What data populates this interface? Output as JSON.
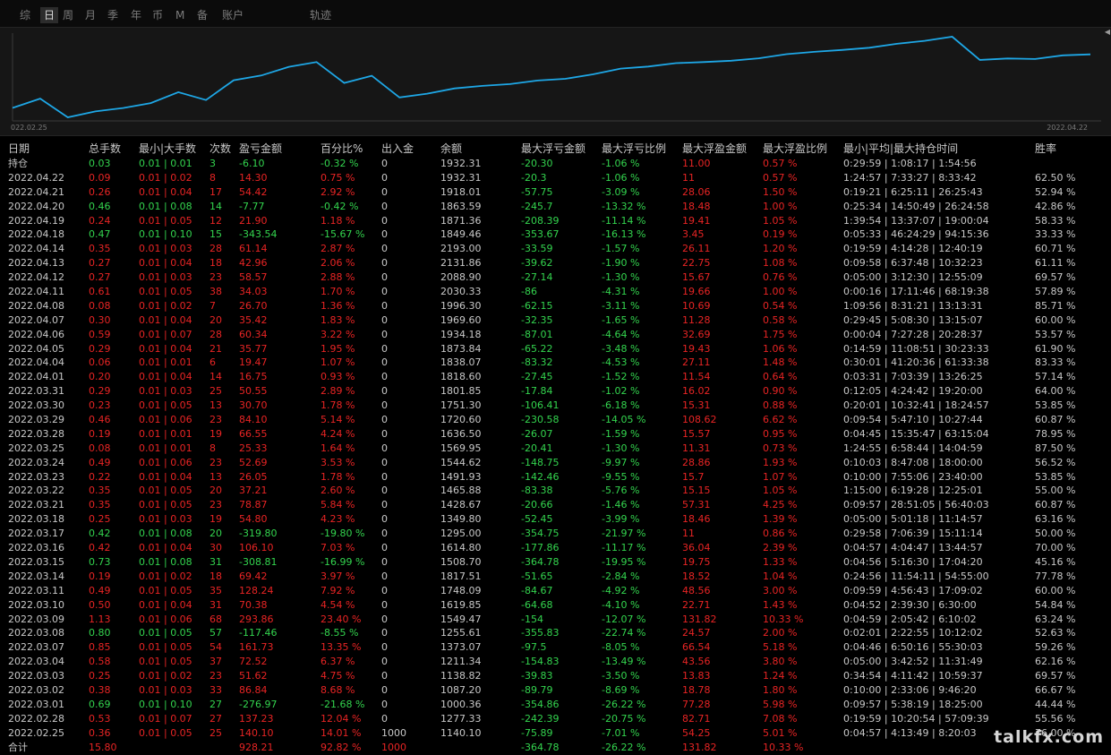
{
  "tabs": [
    {
      "label": "综",
      "active": false
    },
    {
      "label": "日",
      "active": true
    },
    {
      "label": "周",
      "active": false
    },
    {
      "label": "月",
      "active": false
    },
    {
      "label": "季",
      "active": false
    },
    {
      "label": "年",
      "active": false
    },
    {
      "label": "币",
      "active": false
    },
    {
      "label": "M",
      "active": false
    },
    {
      "label": "备",
      "active": false
    },
    {
      "label": "账户",
      "active": false
    },
    {
      "label": "轨迹",
      "active": false
    }
  ],
  "chart": {
    "date_start": "022.02.25",
    "date_end": "2022.04.22",
    "line_color": "#1ea7e6",
    "values": [
      1140.1,
      1277.33,
      1000.36,
      1087.2,
      1138.82,
      1211.34,
      1373.07,
      1255.61,
      1549.47,
      1619.85,
      1748.09,
      1817.51,
      1508.7,
      1614.8,
      1295.0,
      1349.8,
      1428.67,
      1465.88,
      1491.93,
      1544.62,
      1569.95,
      1636.5,
      1720.6,
      1751.3,
      1801.85,
      1818.6,
      1838.07,
      1873.84,
      1934.18,
      1969.6,
      1996.3,
      2030.33,
      2088.9,
      2131.86,
      2193.0,
      1849.46,
      1871.36,
      1863.59,
      1918.01,
      1932.31
    ]
  },
  "headers": [
    "日期",
    "总手数",
    "最小|大手数",
    "次数",
    "盈亏金额",
    "百分比%",
    "出入金",
    "余额",
    "最大浮亏金额",
    "最大浮亏比例",
    "最大浮盈金额",
    "最大浮盈比例",
    "最小|平均|最大持仓时间",
    "胜率"
  ],
  "holding": {
    "date": "持仓",
    "lots": "0.03",
    "minmax": "0.01 | 0.01",
    "count": "3",
    "pnl": "-6.10",
    "pct": "-0.32 %",
    "io": "0",
    "balance": "1932.31",
    "maxloss": "-20.30",
    "maxlosspct": "-1.06 %",
    "maxprofit": "11.00",
    "maxprofitpct": "0.57 %",
    "time": "0:29:59 | 1:08:17 | 1:54:56",
    "win": ""
  },
  "rows": [
    {
      "date": "2022.04.22",
      "lots": "0.09",
      "minmax": "0.01 | 0.02",
      "count": "8",
      "pnl": "14.30",
      "pct": "0.75 %",
      "io": "0",
      "balance": "1932.31",
      "maxloss": "-20.3",
      "maxlosspct": "-1.06 %",
      "maxprofit": "11",
      "maxprofitpct": "0.57 %",
      "time": "1:24:57 | 7:33:27 | 8:33:42",
      "win": "62.50 %"
    },
    {
      "date": "2022.04.21",
      "lots": "0.26",
      "minmax": "0.01 | 0.04",
      "count": "17",
      "pnl": "54.42",
      "pct": "2.92 %",
      "io": "0",
      "balance": "1918.01",
      "maxloss": "-57.75",
      "maxlosspct": "-3.09 %",
      "maxprofit": "28.06",
      "maxprofitpct": "1.50 %",
      "time": "0:19:21 | 6:25:11 | 26:25:43",
      "win": "52.94 %"
    },
    {
      "date": "2022.04.20",
      "lots": "0.46",
      "minmax": "0.01 | 0.08",
      "count": "14",
      "pnl": "-7.77",
      "pct": "-0.42 %",
      "io": "0",
      "balance": "1863.59",
      "maxloss": "-245.7",
      "maxlosspct": "-13.32 %",
      "maxprofit": "18.48",
      "maxprofitpct": "1.00 %",
      "time": "0:25:34 | 14:50:49 | 26:24:58",
      "win": "42.86 %"
    },
    {
      "date": "2022.04.19",
      "lots": "0.24",
      "minmax": "0.01 | 0.05",
      "count": "12",
      "pnl": "21.90",
      "pct": "1.18 %",
      "io": "0",
      "balance": "1871.36",
      "maxloss": "-208.39",
      "maxlosspct": "-11.14 %",
      "maxprofit": "19.41",
      "maxprofitpct": "1.05 %",
      "time": "1:39:54 | 13:37:07 | 19:00:04",
      "win": "58.33 %"
    },
    {
      "date": "2022.04.18",
      "lots": "0.47",
      "minmax": "0.01 | 0.10",
      "count": "15",
      "pnl": "-343.54",
      "pct": "-15.67 %",
      "io": "0",
      "balance": "1849.46",
      "maxloss": "-353.67",
      "maxlosspct": "-16.13 %",
      "maxprofit": "3.45",
      "maxprofitpct": "0.19 %",
      "time": "0:05:33 | 46:24:29 | 94:15:36",
      "win": "33.33 %"
    },
    {
      "date": "2022.04.14",
      "lots": "0.35",
      "minmax": "0.01 | 0.03",
      "count": "28",
      "pnl": "61.14",
      "pct": "2.87 %",
      "io": "0",
      "balance": "2193.00",
      "maxloss": "-33.59",
      "maxlosspct": "-1.57 %",
      "maxprofit": "26.11",
      "maxprofitpct": "1.20 %",
      "time": "0:19:59 | 4:14:28 | 12:40:19",
      "win": "60.71 %"
    },
    {
      "date": "2022.04.13",
      "lots": "0.27",
      "minmax": "0.01 | 0.04",
      "count": "18",
      "pnl": "42.96",
      "pct": "2.06 %",
      "io": "0",
      "balance": "2131.86",
      "maxloss": "-39.62",
      "maxlosspct": "-1.90 %",
      "maxprofit": "22.75",
      "maxprofitpct": "1.08 %",
      "time": "0:09:58 | 6:37:48 | 10:32:23",
      "win": "61.11 %"
    },
    {
      "date": "2022.04.12",
      "lots": "0.27",
      "minmax": "0.01 | 0.03",
      "count": "23",
      "pnl": "58.57",
      "pct": "2.88 %",
      "io": "0",
      "balance": "2088.90",
      "maxloss": "-27.14",
      "maxlosspct": "-1.30 %",
      "maxprofit": "15.67",
      "maxprofitpct": "0.76 %",
      "time": "0:05:00 | 3:12:30 | 12:55:09",
      "win": "69.57 %"
    },
    {
      "date": "2022.04.11",
      "lots": "0.61",
      "minmax": "0.01 | 0.05",
      "count": "38",
      "pnl": "34.03",
      "pct": "1.70 %",
      "io": "0",
      "balance": "2030.33",
      "maxloss": "-86",
      "maxlosspct": "-4.31 %",
      "maxprofit": "19.66",
      "maxprofitpct": "1.00 %",
      "time": "0:00:16 | 17:11:46 | 68:19:38",
      "win": "57.89 %"
    },
    {
      "date": "2022.04.08",
      "lots": "0.08",
      "minmax": "0.01 | 0.02",
      "count": "7",
      "pnl": "26.70",
      "pct": "1.36 %",
      "io": "0",
      "balance": "1996.30",
      "maxloss": "-62.15",
      "maxlosspct": "-3.11 %",
      "maxprofit": "10.69",
      "maxprofitpct": "0.54 %",
      "time": "1:09:56 | 8:31:21 | 13:13:31",
      "win": "85.71 %"
    },
    {
      "date": "2022.04.07",
      "lots": "0.30",
      "minmax": "0.01 | 0.04",
      "count": "20",
      "pnl": "35.42",
      "pct": "1.83 %",
      "io": "0",
      "balance": "1969.60",
      "maxloss": "-32.35",
      "maxlosspct": "-1.65 %",
      "maxprofit": "11.28",
      "maxprofitpct": "0.58 %",
      "time": "0:29:45 | 5:08:30 | 13:15:07",
      "win": "60.00 %"
    },
    {
      "date": "2022.04.06",
      "lots": "0.59",
      "minmax": "0.01 | 0.07",
      "count": "28",
      "pnl": "60.34",
      "pct": "3.22 %",
      "io": "0",
      "balance": "1934.18",
      "maxloss": "-87.01",
      "maxlosspct": "-4.64 %",
      "maxprofit": "32.69",
      "maxprofitpct": "1.75 %",
      "time": "0:00:04 | 7:27:28 | 20:28:37",
      "win": "53.57 %"
    },
    {
      "date": "2022.04.05",
      "lots": "0.29",
      "minmax": "0.01 | 0.04",
      "count": "21",
      "pnl": "35.77",
      "pct": "1.95 %",
      "io": "0",
      "balance": "1873.84",
      "maxloss": "-65.22",
      "maxlosspct": "-3.48 %",
      "maxprofit": "19.43",
      "maxprofitpct": "1.06 %",
      "time": "0:14:59 | 11:08:51 | 30:23:33",
      "win": "61.90 %"
    },
    {
      "date": "2022.04.04",
      "lots": "0.06",
      "minmax": "0.01 | 0.01",
      "count": "6",
      "pnl": "19.47",
      "pct": "1.07 %",
      "io": "0",
      "balance": "1838.07",
      "maxloss": "-83.32",
      "maxlosspct": "-4.53 %",
      "maxprofit": "27.11",
      "maxprofitpct": "1.48 %",
      "time": "0:30:01 | 41:20:36 | 61:33:38",
      "win": "83.33 %"
    },
    {
      "date": "2022.04.01",
      "lots": "0.20",
      "minmax": "0.01 | 0.04",
      "count": "14",
      "pnl": "16.75",
      "pct": "0.93 %",
      "io": "0",
      "balance": "1818.60",
      "maxloss": "-27.45",
      "maxlosspct": "-1.52 %",
      "maxprofit": "11.54",
      "maxprofitpct": "0.64 %",
      "time": "0:03:31 | 7:03:39 | 13:26:25",
      "win": "57.14 %"
    },
    {
      "date": "2022.03.31",
      "lots": "0.29",
      "minmax": "0.01 | 0.03",
      "count": "25",
      "pnl": "50.55",
      "pct": "2.89 %",
      "io": "0",
      "balance": "1801.85",
      "maxloss": "-17.84",
      "maxlosspct": "-1.02 %",
      "maxprofit": "16.02",
      "maxprofitpct": "0.90 %",
      "time": "0:12:05 | 4:24:42 | 19:20:00",
      "win": "64.00 %"
    },
    {
      "date": "2022.03.30",
      "lots": "0.23",
      "minmax": "0.01 | 0.05",
      "count": "13",
      "pnl": "30.70",
      "pct": "1.78 %",
      "io": "0",
      "balance": "1751.30",
      "maxloss": "-106.41",
      "maxlosspct": "-6.18 %",
      "maxprofit": "15.31",
      "maxprofitpct": "0.88 %",
      "time": "0:20:01 | 10:32:41 | 18:24:57",
      "win": "53.85 %"
    },
    {
      "date": "2022.03.29",
      "lots": "0.46",
      "minmax": "0.01 | 0.06",
      "count": "23",
      "pnl": "84.10",
      "pct": "5.14 %",
      "io": "0",
      "balance": "1720.60",
      "maxloss": "-230.58",
      "maxlosspct": "-14.05 %",
      "maxprofit": "108.62",
      "maxprofitpct": "6.62 %",
      "time": "0:09:54 | 5:47:10 | 10:27:44",
      "win": "60.87 %"
    },
    {
      "date": "2022.03.28",
      "lots": "0.19",
      "minmax": "0.01 | 0.01",
      "count": "19",
      "pnl": "66.55",
      "pct": "4.24 %",
      "io": "0",
      "balance": "1636.50",
      "maxloss": "-26.07",
      "maxlosspct": "-1.59 %",
      "maxprofit": "15.57",
      "maxprofitpct": "0.95 %",
      "time": "0:04:45 | 15:35:47 | 63:15:04",
      "win": "78.95 %"
    },
    {
      "date": "2022.03.25",
      "lots": "0.08",
      "minmax": "0.01 | 0.01",
      "count": "8",
      "pnl": "25.33",
      "pct": "1.64 %",
      "io": "0",
      "balance": "1569.95",
      "maxloss": "-20.41",
      "maxlosspct": "-1.30 %",
      "maxprofit": "11.31",
      "maxprofitpct": "0.73 %",
      "time": "1:24:55 | 6:58:44 | 14:04:59",
      "win": "87.50 %"
    },
    {
      "date": "2022.03.24",
      "lots": "0.49",
      "minmax": "0.01 | 0.06",
      "count": "23",
      "pnl": "52.69",
      "pct": "3.53 %",
      "io": "0",
      "balance": "1544.62",
      "maxloss": "-148.75",
      "maxlosspct": "-9.97 %",
      "maxprofit": "28.86",
      "maxprofitpct": "1.93 %",
      "time": "0:10:03 | 8:47:08 | 18:00:00",
      "win": "56.52 %"
    },
    {
      "date": "2022.03.23",
      "lots": "0.22",
      "minmax": "0.01 | 0.04",
      "count": "13",
      "pnl": "26.05",
      "pct": "1.78 %",
      "io": "0",
      "balance": "1491.93",
      "maxloss": "-142.46",
      "maxlosspct": "-9.55 %",
      "maxprofit": "15.7",
      "maxprofitpct": "1.07 %",
      "time": "0:10:00 | 7:55:06 | 23:40:00",
      "win": "53.85 %"
    },
    {
      "date": "2022.03.22",
      "lots": "0.35",
      "minmax": "0.01 | 0.05",
      "count": "20",
      "pnl": "37.21",
      "pct": "2.60 %",
      "io": "0",
      "balance": "1465.88",
      "maxloss": "-83.38",
      "maxlosspct": "-5.76 %",
      "maxprofit": "15.15",
      "maxprofitpct": "1.05 %",
      "time": "1:15:00 | 6:19:28 | 12:25:01",
      "win": "55.00 %"
    },
    {
      "date": "2022.03.21",
      "lots": "0.35",
      "minmax": "0.01 | 0.05",
      "count": "23",
      "pnl": "78.87",
      "pct": "5.84 %",
      "io": "0",
      "balance": "1428.67",
      "maxloss": "-20.66",
      "maxlosspct": "-1.46 %",
      "maxprofit": "57.31",
      "maxprofitpct": "4.25 %",
      "time": "0:09:57 | 28:51:05 | 56:40:03",
      "win": "60.87 %"
    },
    {
      "date": "2022.03.18",
      "lots": "0.25",
      "minmax": "0.01 | 0.03",
      "count": "19",
      "pnl": "54.80",
      "pct": "4.23 %",
      "io": "0",
      "balance": "1349.80",
      "maxloss": "-52.45",
      "maxlosspct": "-3.99 %",
      "maxprofit": "18.46",
      "maxprofitpct": "1.39 %",
      "time": "0:05:00 | 5:01:18 | 11:14:57",
      "win": "63.16 %"
    },
    {
      "date": "2022.03.17",
      "lots": "0.42",
      "minmax": "0.01 | 0.08",
      "count": "20",
      "pnl": "-319.80",
      "pct": "-19.80 %",
      "io": "0",
      "balance": "1295.00",
      "maxloss": "-354.75",
      "maxlosspct": "-21.97 %",
      "maxprofit": "11",
      "maxprofitpct": "0.86 %",
      "time": "0:29:58 | 7:06:39 | 15:11:14",
      "win": "50.00 %"
    },
    {
      "date": "2022.03.16",
      "lots": "0.42",
      "minmax": "0.01 | 0.04",
      "count": "30",
      "pnl": "106.10",
      "pct": "7.03 %",
      "io": "0",
      "balance": "1614.80",
      "maxloss": "-177.86",
      "maxlosspct": "-11.17 %",
      "maxprofit": "36.04",
      "maxprofitpct": "2.39 %",
      "time": "0:04:57 | 4:04:47 | 13:44:57",
      "win": "70.00 %"
    },
    {
      "date": "2022.03.15",
      "lots": "0.73",
      "minmax": "0.01 | 0.08",
      "count": "31",
      "pnl": "-308.81",
      "pct": "-16.99 %",
      "io": "0",
      "balance": "1508.70",
      "maxloss": "-364.78",
      "maxlosspct": "-19.95 %",
      "maxprofit": "19.75",
      "maxprofitpct": "1.33 %",
      "time": "0:04:56 | 5:16:30 | 17:04:20",
      "win": "45.16 %"
    },
    {
      "date": "2022.03.14",
      "lots": "0.19",
      "minmax": "0.01 | 0.02",
      "count": "18",
      "pnl": "69.42",
      "pct": "3.97 %",
      "io": "0",
      "balance": "1817.51",
      "maxloss": "-51.65",
      "maxlosspct": "-2.84 %",
      "maxprofit": "18.52",
      "maxprofitpct": "1.04 %",
      "time": "0:24:56 | 11:54:11 | 54:55:00",
      "win": "77.78 %"
    },
    {
      "date": "2022.03.11",
      "lots": "0.49",
      "minmax": "0.01 | 0.05",
      "count": "35",
      "pnl": "128.24",
      "pct": "7.92 %",
      "io": "0",
      "balance": "1748.09",
      "maxloss": "-84.67",
      "maxlosspct": "-4.92 %",
      "maxprofit": "48.56",
      "maxprofitpct": "3.00 %",
      "time": "0:09:59 | 4:56:43 | 17:09:02",
      "win": "60.00 %"
    },
    {
      "date": "2022.03.10",
      "lots": "0.50",
      "minmax": "0.01 | 0.04",
      "count": "31",
      "pnl": "70.38",
      "pct": "4.54 %",
      "io": "0",
      "balance": "1619.85",
      "maxloss": "-64.68",
      "maxlosspct": "-4.10 %",
      "maxprofit": "22.71",
      "maxprofitpct": "1.43 %",
      "time": "0:04:52 | 2:39:30 | 6:30:00",
      "win": "54.84 %"
    },
    {
      "date": "2022.03.09",
      "lots": "1.13",
      "minmax": "0.01 | 0.06",
      "count": "68",
      "pnl": "293.86",
      "pct": "23.40 %",
      "io": "0",
      "balance": "1549.47",
      "maxloss": "-154",
      "maxlosspct": "-12.07 %",
      "maxprofit": "131.82",
      "maxprofitpct": "10.33 %",
      "time": "0:04:59 | 2:05:42 | 6:10:02",
      "win": "63.24 %"
    },
    {
      "date": "2022.03.08",
      "lots": "0.80",
      "minmax": "0.01 | 0.05",
      "count": "57",
      "pnl": "-117.46",
      "pct": "-8.55 %",
      "io": "0",
      "balance": "1255.61",
      "maxloss": "-355.83",
      "maxlosspct": "-22.74 %",
      "maxprofit": "24.57",
      "maxprofitpct": "2.00 %",
      "time": "0:02:01 | 2:22:55 | 10:12:02",
      "win": "52.63 %"
    },
    {
      "date": "2022.03.07",
      "lots": "0.85",
      "minmax": "0.01 | 0.05",
      "count": "54",
      "pnl": "161.73",
      "pct": "13.35 %",
      "io": "0",
      "balance": "1373.07",
      "maxloss": "-97.5",
      "maxlosspct": "-8.05 %",
      "maxprofit": "66.54",
      "maxprofitpct": "5.18 %",
      "time": "0:04:46 | 6:50:16 | 55:30:03",
      "win": "59.26 %"
    },
    {
      "date": "2022.03.04",
      "lots": "0.58",
      "minmax": "0.01 | 0.05",
      "count": "37",
      "pnl": "72.52",
      "pct": "6.37 %",
      "io": "0",
      "balance": "1211.34",
      "maxloss": "-154.83",
      "maxlosspct": "-13.49 %",
      "maxprofit": "43.56",
      "maxprofitpct": "3.80 %",
      "time": "0:05:00 | 3:42:52 | 11:31:49",
      "win": "62.16 %"
    },
    {
      "date": "2022.03.03",
      "lots": "0.25",
      "minmax": "0.01 | 0.02",
      "count": "23",
      "pnl": "51.62",
      "pct": "4.75 %",
      "io": "0",
      "balance": "1138.82",
      "maxloss": "-39.83",
      "maxlosspct": "-3.50 %",
      "maxprofit": "13.83",
      "maxprofitpct": "1.24 %",
      "time": "0:34:54 | 4:11:42 | 10:59:37",
      "win": "69.57 %"
    },
    {
      "date": "2022.03.02",
      "lots": "0.38",
      "minmax": "0.01 | 0.03",
      "count": "33",
      "pnl": "86.84",
      "pct": "8.68 %",
      "io": "0",
      "balance": "1087.20",
      "maxloss": "-89.79",
      "maxlosspct": "-8.69 %",
      "maxprofit": "18.78",
      "maxprofitpct": "1.80 %",
      "time": "0:10:00 | 2:33:06 | 9:46:20",
      "win": "66.67 %"
    },
    {
      "date": "2022.03.01",
      "lots": "0.69",
      "minmax": "0.01 | 0.10",
      "count": "27",
      "pnl": "-276.97",
      "pct": "-21.68 %",
      "io": "0",
      "balance": "1000.36",
      "maxloss": "-354.86",
      "maxlosspct": "-26.22 %",
      "maxprofit": "77.28",
      "maxprofitpct": "5.98 %",
      "time": "0:09:57 | 5:38:19 | 18:25:00",
      "win": "44.44 %"
    },
    {
      "date": "2022.02.28",
      "lots": "0.53",
      "minmax": "0.01 | 0.07",
      "count": "27",
      "pnl": "137.23",
      "pct": "12.04 %",
      "io": "0",
      "balance": "1277.33",
      "maxloss": "-242.39",
      "maxlosspct": "-20.75 %",
      "maxprofit": "82.71",
      "maxprofitpct": "7.08 %",
      "time": "0:19:59 | 10:20:54 | 57:09:39",
      "win": "55.56 %"
    },
    {
      "date": "2022.02.25",
      "lots": "0.36",
      "minmax": "0.01 | 0.05",
      "count": "25",
      "pnl": "140.10",
      "pct": "14.01 %",
      "io": "1000",
      "balance": "1140.10",
      "maxloss": "-75.89",
      "maxlosspct": "-7.01 %",
      "maxprofit": "54.25",
      "maxprofitpct": "5.01 %",
      "time": "0:04:57 | 4:13:49 | 8:20:03",
      "win": "76.00 %"
    }
  ],
  "footer": {
    "date": "合计",
    "lots": "15.80",
    "pnl": "928.21",
    "pct": "92.82 %",
    "io": "1000",
    "maxloss": "-364.78",
    "maxlosspct": "-26.22 %",
    "maxprofit": "131.82",
    "maxprofitpct": "10.33 %"
  },
  "colors": {
    "positive": "#e82424",
    "negative": "#33d44e",
    "neutral": "#c8c8c8"
  },
  "watermark": "talkfx.com"
}
